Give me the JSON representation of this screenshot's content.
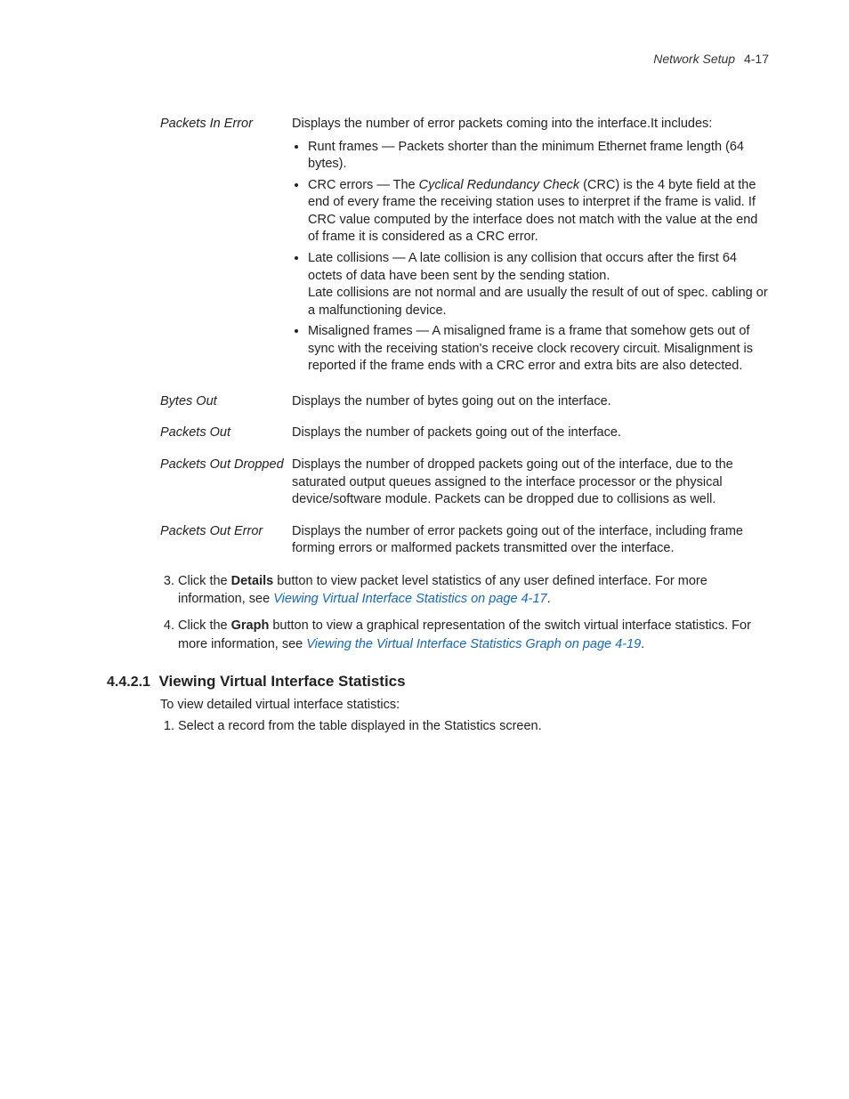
{
  "header": {
    "section": "Network Setup",
    "page": "4-17"
  },
  "definitions": [
    {
      "term": "Packets In Error",
      "lead": "Displays the number of error packets coming into the interface.It includes:",
      "bullets": [
        {
          "text": "Runt frames — Packets shorter than the minimum Ethernet frame length (64 bytes)."
        },
        {
          "prefix": "CRC errors — The ",
          "emph": "Cyclical Redundancy Check",
          "suffix": " (CRC) is the 4 byte field at the end of every frame the receiving station uses to interpret if the frame is valid. If CRC value computed by the interface does not match with the value at the end of frame it is considered as a CRC error."
        },
        {
          "text": "Late collisions — A late collision is any collision that occurs after the first 64 octets of data have been sent by the sending station.\nLate collisions are not normal and are usually the result of out of spec. cabling or a malfunctioning device."
        },
        {
          "text": "Misaligned frames — A misaligned frame is a frame that somehow gets out of sync with the receiving station's receive clock recovery circuit. Misalignment is reported if the frame ends with a CRC error and extra bits are also detected."
        }
      ]
    },
    {
      "term": "Bytes Out",
      "lead": "Displays the number of bytes going out on the interface."
    },
    {
      "term": "Packets Out",
      "lead": "Displays the number of packets going out of the interface."
    },
    {
      "term": "Packets Out Dropped",
      "lead": "Displays the number of dropped packets going out of the interface, due to the saturated output queues assigned to the interface processor or the physical device/software module. Packets can be dropped due to collisions as well."
    },
    {
      "term": "Packets Out Error",
      "lead": "Displays the number of error packets going out of the interface, including frame forming errors or malformed packets transmitted over the interface."
    }
  ],
  "steps_a": [
    {
      "pre": "Click the ",
      "bold": "Details",
      "mid": " button to view packet level statistics of any user defined interface. For more information, see ",
      "link": "Viewing Virtual Interface Statistics on page 4-17",
      "post": "."
    },
    {
      "pre": "Click the ",
      "bold": "Graph",
      "mid": " button to view a graphical representation of the switch virtual interface statistics. For more information, see ",
      "link": "Viewing the Virtual Interface Statistics Graph on page 4-19",
      "post": "."
    }
  ],
  "section": {
    "number": "4.4.2.1",
    "title": "Viewing Virtual Interface Statistics",
    "intro": "To view detailed virtual interface statistics:",
    "steps": [
      "Select a record from the table displayed in the Statistics screen."
    ]
  }
}
